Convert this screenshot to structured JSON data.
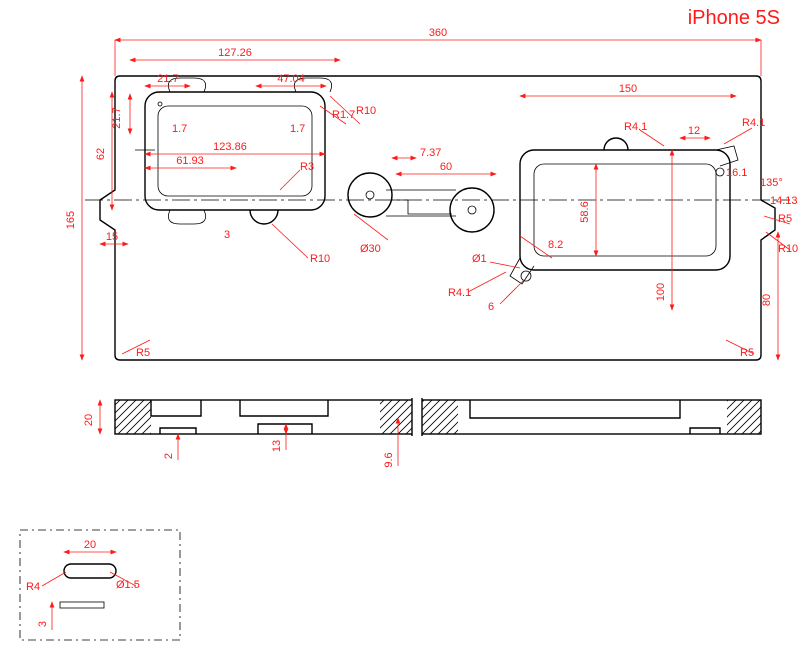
{
  "title": "iPhone 5S",
  "dims": {
    "d360": "360",
    "d127_26": "127.26",
    "d150": "150",
    "d21_7": "21.7",
    "d47_04": "47.04",
    "r1_7": "R1.7",
    "r10a": "R10",
    "d21_7v": "21.7",
    "d1_7": "1.7",
    "d1_7b": "1.7",
    "d123_86": "123.86",
    "d61_93": "61.93",
    "d62": "62",
    "d165": "165",
    "d15": "15",
    "d3": "3",
    "r3": "R3",
    "r10b": "R10",
    "dia30": "Ø30",
    "d7_37": "7.37",
    "d60": "60",
    "r4_1a": "R4.1",
    "d12": "12",
    "r4_1b": "R4.1",
    "d16_1": "16.1",
    "ang135": "135°",
    "d14_13": "14.13",
    "r5a": "R5",
    "r10c": "R10",
    "d58_6": "58.6",
    "d8_2": "8.2",
    "r4_1c": "R4.1",
    "dia1": "Ø1",
    "d6": "6",
    "d100": "100",
    "d80": "80",
    "r5b": "R5",
    "r5c": "R5",
    "sec20": "20",
    "sec13": "13",
    "sec2": "2",
    "sec9_6": "9.6",
    "det20": "20",
    "detR4": "R4",
    "detDia1_5": "Ø1.5",
    "det3": "3"
  }
}
